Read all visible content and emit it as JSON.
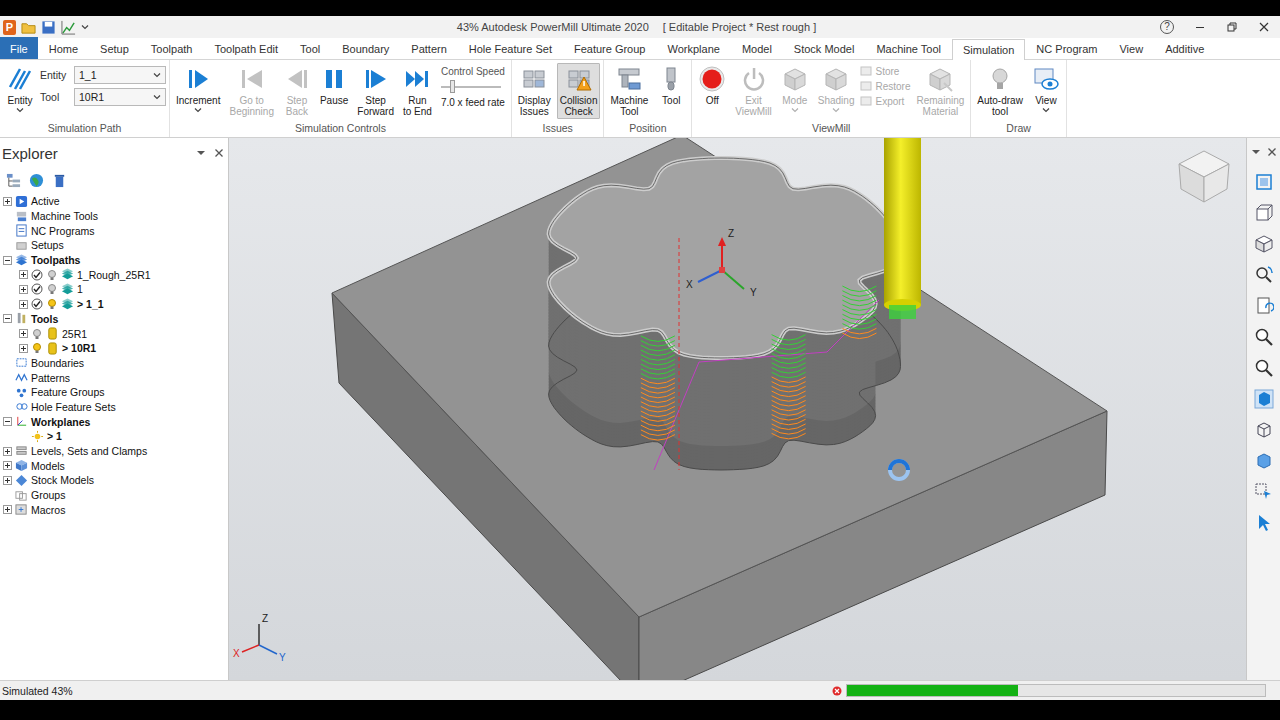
{
  "app": {
    "logo": "P",
    "title": "43% Autodesk PowerMill Ultimate 2020",
    "project": "[ Editable Project * Rest rough ]",
    "help": "?"
  },
  "tabs": [
    {
      "label": "File",
      "kind": "file",
      "selected": false
    },
    {
      "label": "Home",
      "kind": "tab",
      "selected": false
    },
    {
      "label": "Setup",
      "kind": "tab",
      "selected": false
    },
    {
      "label": "Toolpath",
      "kind": "tab",
      "selected": false
    },
    {
      "label": "Toolpath Edit",
      "kind": "tab",
      "selected": false
    },
    {
      "label": "Tool",
      "kind": "tab",
      "selected": false
    },
    {
      "label": "Boundary",
      "kind": "tab",
      "selected": false
    },
    {
      "label": "Pattern",
      "kind": "tab",
      "selected": false
    },
    {
      "label": "Hole Feature Set",
      "kind": "tab",
      "selected": false
    },
    {
      "label": "Feature Group",
      "kind": "tab",
      "selected": false
    },
    {
      "label": "Workplane",
      "kind": "tab",
      "selected": false
    },
    {
      "label": "Model",
      "kind": "tab",
      "selected": false
    },
    {
      "label": "Stock Model",
      "kind": "tab",
      "selected": false
    },
    {
      "label": "Machine Tool",
      "kind": "tab",
      "selected": false
    },
    {
      "label": "Simulation",
      "kind": "tab",
      "selected": true
    },
    {
      "label": "NC Program",
      "kind": "tab",
      "selected": false
    },
    {
      "label": "View",
      "kind": "tab",
      "selected": false
    },
    {
      "label": "Additive",
      "kind": "tab",
      "selected": false
    }
  ],
  "ribbon": {
    "simulation_path": {
      "label": "Simulation Path",
      "entity": {
        "lines": [
          "Entity"
        ],
        "dropdown": true
      },
      "fields": [
        {
          "label": "Entity",
          "value": "1_1"
        },
        {
          "label": "Tool",
          "value": "10R1"
        }
      ]
    },
    "simulation_controls": {
      "label": "Simulation Controls",
      "buttons": [
        {
          "lines": [
            "Increment"
          ],
          "disabled": false,
          "dropdown": true
        },
        {
          "lines": [
            "Go to",
            "Beginning"
          ],
          "disabled": true,
          "dropdown": false
        },
        {
          "lines": [
            "Step",
            "Back"
          ],
          "disabled": true,
          "dropdown": false
        },
        {
          "lines": [
            "Pause"
          ],
          "disabled": false,
          "dropdown": false
        },
        {
          "lines": [
            "Step",
            "Forward"
          ],
          "disabled": false,
          "dropdown": false
        },
        {
          "lines": [
            "Run",
            "to End"
          ],
          "disabled": false,
          "dropdown": false
        }
      ],
      "speed": {
        "label": "Control Speed",
        "level": 0.18,
        "reading": "7.0 x feed rate"
      }
    },
    "issues": {
      "label": "Issues",
      "buttons": [
        {
          "lines": [
            "Display",
            "Issues"
          ],
          "selected": false
        },
        {
          "lines": [
            "Collision",
            "Check"
          ],
          "selected": true
        }
      ]
    },
    "position": {
      "label": "Position",
      "buttons": [
        {
          "lines": [
            "Machine",
            "Tool"
          ]
        },
        {
          "lines": [
            "Tool"
          ]
        }
      ]
    },
    "viewmill": {
      "label": "ViewMill",
      "buttons": [
        {
          "lines": [
            "Off"
          ],
          "disabled": false,
          "dropdown": false
        },
        {
          "lines": [
            "Exit",
            "ViewMill"
          ],
          "disabled": true,
          "dropdown": false
        },
        {
          "lines": [
            "Mode"
          ],
          "disabled": true,
          "dropdown": true
        },
        {
          "lines": [
            "Shading"
          ],
          "disabled": true,
          "dropdown": true
        }
      ],
      "small_buttons": [
        {
          "label": "Store",
          "disabled": true
        },
        {
          "label": "Restore",
          "disabled": true
        },
        {
          "label": "Export",
          "disabled": true
        }
      ],
      "remaining": {
        "lines": [
          "Remaining",
          "Material"
        ],
        "disabled": true
      }
    },
    "draw": {
      "label": "Draw",
      "buttons": [
        {
          "lines": [
            "Auto-draw",
            "tool"
          ],
          "dropdown": false
        },
        {
          "lines": [
            "View"
          ],
          "dropdown": true
        }
      ]
    }
  },
  "explorer": {
    "title": "Explorer",
    "items": [
      {
        "label": "Active",
        "level": 0,
        "kind": "active",
        "expandable": true,
        "expanded": false,
        "bold": false
      },
      {
        "label": "Machine Tools",
        "level": 0,
        "kind": "machine_tools",
        "expandable": false,
        "expanded": false,
        "bold": false
      },
      {
        "label": "NC Programs",
        "level": 0,
        "kind": "nc_programs",
        "expandable": false,
        "expanded": false,
        "bold": false
      },
      {
        "label": "Setups",
        "level": 0,
        "kind": "setups",
        "expandable": false,
        "expanded": false,
        "bold": false
      },
      {
        "label": "Toolpaths",
        "level": 0,
        "kind": "toolpaths",
        "expandable": true,
        "expanded": true,
        "bold": true
      },
      {
        "label": "1_Rough_25R1",
        "level": 1,
        "kind": "toolpath",
        "expandable": true,
        "expanded": false,
        "bold": false,
        "checked": true,
        "lit": false
      },
      {
        "label": "1",
        "level": 1,
        "kind": "toolpath",
        "expandable": true,
        "expanded": false,
        "bold": false,
        "checked": true,
        "lit": false
      },
      {
        "label": "> 1_1",
        "level": 1,
        "kind": "toolpath",
        "expandable": true,
        "expanded": false,
        "bold": true,
        "checked": true,
        "lit": true
      },
      {
        "label": "Tools",
        "level": 0,
        "kind": "tools",
        "expandable": true,
        "expanded": true,
        "bold": true
      },
      {
        "label": "25R1",
        "level": 1,
        "kind": "tool",
        "expandable": true,
        "expanded": false,
        "bold": false,
        "lit": false
      },
      {
        "label": "> 10R1",
        "level": 1,
        "kind": "tool",
        "expandable": true,
        "expanded": false,
        "bold": true,
        "lit": true
      },
      {
        "label": "Boundaries",
        "level": 0,
        "kind": "boundaries",
        "expandable": false,
        "expanded": false,
        "bold": false
      },
      {
        "label": "Patterns",
        "level": 0,
        "kind": "patterns",
        "expandable": false,
        "expanded": false,
        "bold": false
      },
      {
        "label": "Feature Groups",
        "level": 0,
        "kind": "feature_groups",
        "expandable": false,
        "expanded": false,
        "bold": false
      },
      {
        "label": "Hole Feature Sets",
        "level": 0,
        "kind": "hole_feature_sets",
        "expandable": false,
        "expanded": false,
        "bold": false
      },
      {
        "label": "Workplanes",
        "level": 0,
        "kind": "workplanes",
        "expandable": true,
        "expanded": true,
        "bold": true
      },
      {
        "label": "> 1",
        "level": 1,
        "kind": "workplane",
        "expandable": false,
        "expanded": false,
        "bold": true
      },
      {
        "label": "Levels, Sets and Clamps",
        "level": 0,
        "kind": "levels",
        "expandable": true,
        "expanded": false,
        "bold": false
      },
      {
        "label": "Models",
        "level": 0,
        "kind": "models",
        "expandable": true,
        "expanded": false,
        "bold": false
      },
      {
        "label": "Stock Models",
        "level": 0,
        "kind": "stock_models",
        "expandable": true,
        "expanded": false,
        "bold": false
      },
      {
        "label": "Groups",
        "level": 0,
        "kind": "groups",
        "expandable": false,
        "expanded": false,
        "bold": false
      },
      {
        "label": "Macros",
        "level": 0,
        "kind": "macros",
        "expandable": true,
        "expanded": false,
        "bold": false
      }
    ]
  },
  "viewport": {
    "axes": {
      "z": "Z",
      "x": "X",
      "y": "Y"
    },
    "corner_axes": {
      "z": "Z",
      "x": "X",
      "y": "Y"
    },
    "busy": true
  },
  "status_bar": {
    "text": "Simulated 43%",
    "progress": {
      "level": 0.41
    }
  }
}
